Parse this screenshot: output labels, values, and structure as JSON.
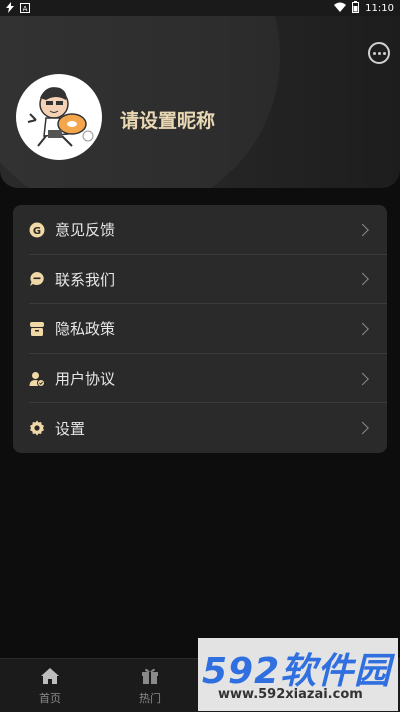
{
  "status": {
    "time": "11:10",
    "left_icons": [
      "lightning-icon",
      "notification-a-icon"
    ],
    "right_icons": [
      "wifi-icon",
      "battery-icon"
    ]
  },
  "header": {
    "nickname": "请设置昵称",
    "message_icon": "chat-bubble-icon",
    "avatar": "cartoon-avatar"
  },
  "menu": {
    "items": [
      {
        "label": "意见反馈",
        "icon": "feedback-g-icon"
      },
      {
        "label": "联系我们",
        "icon": "contact-bubble-icon"
      },
      {
        "label": "隐私政策",
        "icon": "privacy-shop-icon"
      },
      {
        "label": "用户协议",
        "icon": "user-agreement-icon"
      },
      {
        "label": "设置",
        "icon": "gear-icon"
      }
    ]
  },
  "tabbar": {
    "tabs": [
      {
        "label": "首页",
        "icon": "home-icon"
      },
      {
        "label": "热门",
        "icon": "gift-icon"
      }
    ]
  },
  "watermark": {
    "brand": "592软件园",
    "url": "www.592xiazai.com"
  },
  "colors": {
    "accent": "#e9d8b4",
    "icon_gold": "#f0d9a6",
    "card": "#2a2a2a",
    "background": "#0d0d0d"
  }
}
